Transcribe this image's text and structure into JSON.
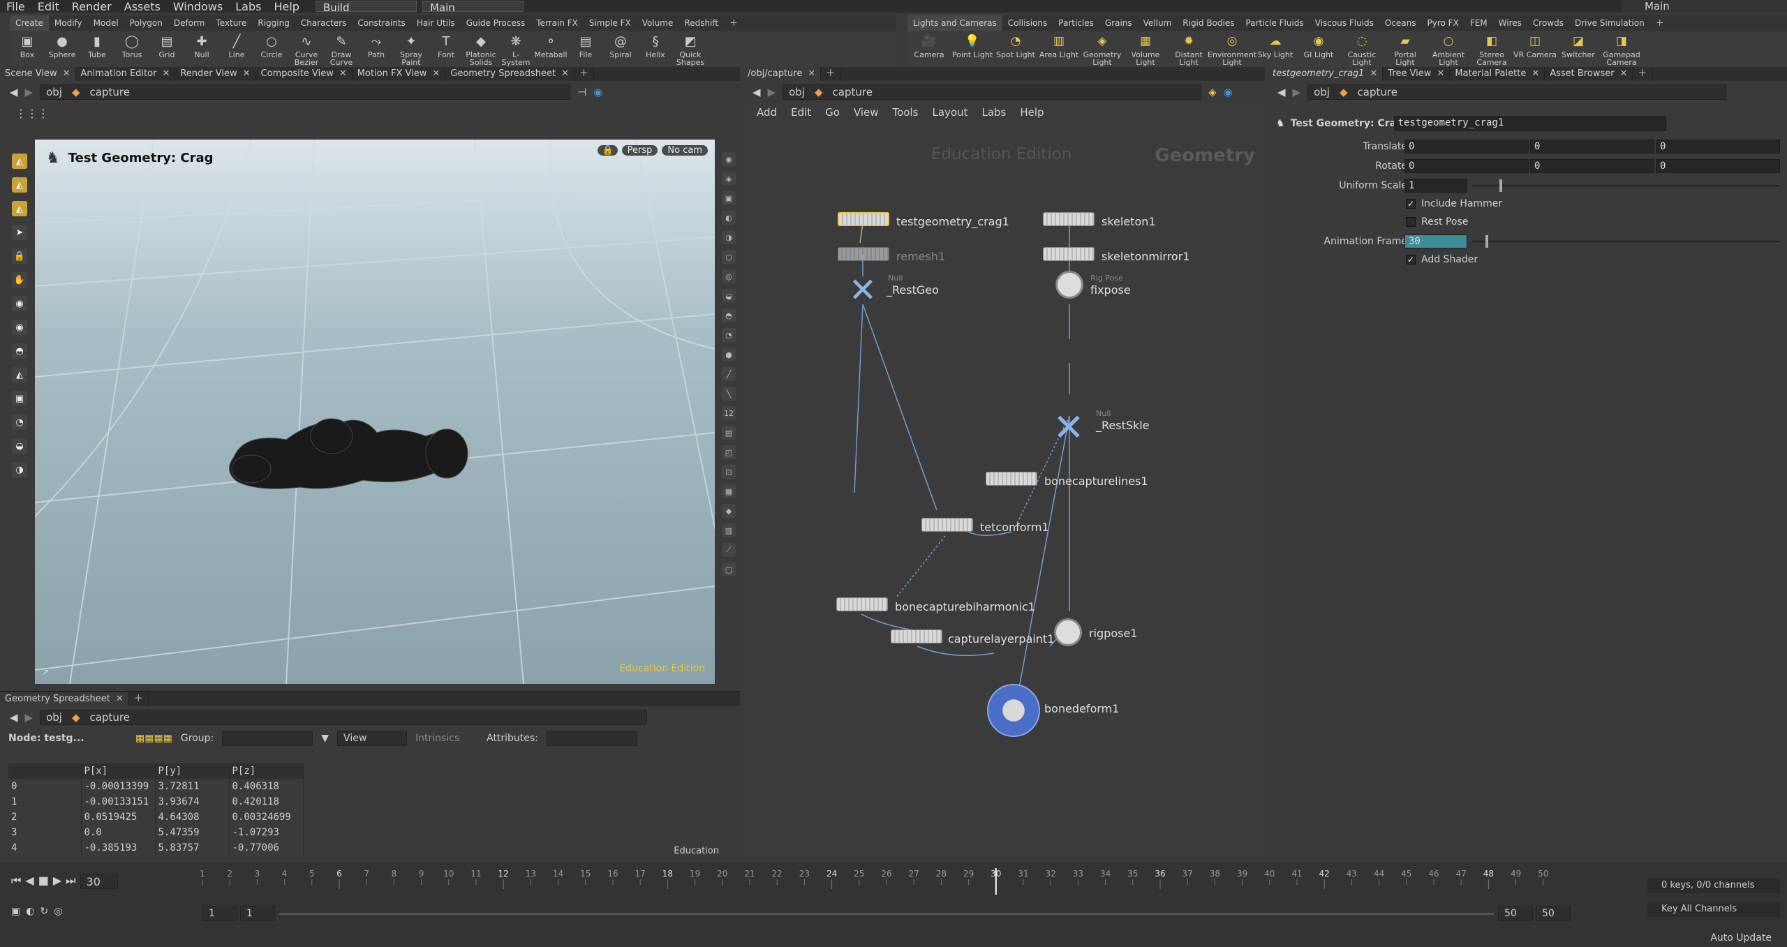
{
  "menu": [
    "File",
    "Edit",
    "Render",
    "Assets",
    "Windows",
    "Labs",
    "Help"
  ],
  "desktop": "Build",
  "workspace": "Main",
  "main_right": "Main",
  "shelf_tabs_left": [
    "Create",
    "Modify",
    "Model",
    "Polygon",
    "Deform",
    "Texture",
    "Rigging",
    "Characters",
    "Constraints",
    "Hair Utils",
    "Guide Process",
    "Terrain FX",
    "Simple FX",
    "Volume",
    "Redshift"
  ],
  "shelf_tabs_right": [
    "Lights and Cameras",
    "Collisions",
    "Particles",
    "Grains",
    "Vellum",
    "Rigid Bodies",
    "Particle Fluids",
    "Viscous Fluids",
    "Oceans",
    "Pyro FX",
    "FEM",
    "Wires",
    "Crowds",
    "Drive Simulation"
  ],
  "tools_left": [
    {
      "label": "Box",
      "icon": "box-icon"
    },
    {
      "label": "Sphere",
      "icon": "sphere-icon"
    },
    {
      "label": "Tube",
      "icon": "tube-icon"
    },
    {
      "label": "Torus",
      "icon": "torus-icon"
    },
    {
      "label": "Grid",
      "icon": "grid-icon"
    },
    {
      "label": "Null",
      "icon": "null-icon"
    },
    {
      "label": "Line",
      "icon": "line-icon"
    },
    {
      "label": "Circle",
      "icon": "circle-icon"
    },
    {
      "label": "Curve Bezier",
      "icon": "curve-bezier-icon"
    },
    {
      "label": "Draw Curve",
      "icon": "draw-curve-icon"
    },
    {
      "label": "Path",
      "icon": "path-icon"
    },
    {
      "label": "Spray Paint",
      "icon": "spray-paint-icon"
    },
    {
      "label": "Font",
      "icon": "font-icon"
    },
    {
      "label": "Platonic Solids",
      "icon": "platonic-icon"
    },
    {
      "label": "L-System",
      "icon": "lsystem-icon"
    },
    {
      "label": "Metaball",
      "icon": "metaball-icon"
    },
    {
      "label": "File",
      "icon": "file-icon"
    },
    {
      "label": "Spiral",
      "icon": "spiral-icon"
    },
    {
      "label": "Helix",
      "icon": "helix-icon"
    },
    {
      "label": "Quick Shapes",
      "icon": "quick-shapes-icon"
    }
  ],
  "tools_right": [
    {
      "label": "Camera"
    },
    {
      "label": "Point Light"
    },
    {
      "label": "Spot Light"
    },
    {
      "label": "Area Light"
    },
    {
      "label": "Geometry Light"
    },
    {
      "label": "Volume Light"
    },
    {
      "label": "Distant Light"
    },
    {
      "label": "Environment Light"
    },
    {
      "label": "Sky Light"
    },
    {
      "label": "GI Light"
    },
    {
      "label": "Caustic Light"
    },
    {
      "label": "Portal Light"
    },
    {
      "label": "Ambient Light"
    },
    {
      "label": "Stereo Camera"
    },
    {
      "label": "VR Camera"
    },
    {
      "label": "Switcher"
    },
    {
      "label": "Gamepad Camera"
    }
  ],
  "left_tabs": [
    "Scene View",
    "Animation Editor",
    "Render View",
    "Composite View",
    "Motion FX View",
    "Geometry Spreadsheet"
  ],
  "mid_tabs": [
    "/obj/capture"
  ],
  "right_tabs": [
    "testgeometry_crag1",
    "Tree View",
    "Material Palette",
    "Asset Browser"
  ],
  "path": {
    "obj": "obj",
    "net": "capture"
  },
  "viewport": {
    "title": "Test Geometry: Crag",
    "persp": "Persp",
    "cam": "No cam",
    "edition": "Education Edition"
  },
  "netmenu": [
    "Add",
    "Edit",
    "Go",
    "View",
    "Tools",
    "Layout",
    "Labs",
    "Help"
  ],
  "net": {
    "watermark": "Education Edition",
    "context": "Geometry",
    "nodes": [
      {
        "id": "n1",
        "label": "testgeometry_crag1"
      },
      {
        "id": "n2",
        "label": "remesh1"
      },
      {
        "id": "n3",
        "label": "_RestGeo",
        "type": "Null"
      },
      {
        "id": "n4",
        "label": "skeleton1"
      },
      {
        "id": "n5",
        "label": "skeletonmirror1"
      },
      {
        "id": "n6",
        "label": "fixpose",
        "type": "Rig Pose"
      },
      {
        "id": "n7",
        "label": "_RestSkle",
        "type": "Null"
      },
      {
        "id": "n8",
        "label": "bonecapturelines1"
      },
      {
        "id": "n9",
        "label": "tetconform1"
      },
      {
        "id": "n10",
        "label": "bonecapturebiharmonic1"
      },
      {
        "id": "n11",
        "label": "capturelayerpaint1"
      },
      {
        "id": "n12",
        "label": "rigpose1"
      },
      {
        "id": "n13",
        "label": "bonedeform1"
      }
    ]
  },
  "params": {
    "header_type": "Test Geometry: Crag",
    "header_name": "testgeometry_crag1",
    "translate_label": "Translate",
    "translate": [
      "0",
      "0",
      "0"
    ],
    "rotate_label": "Rotate",
    "rotate": [
      "0",
      "0",
      "0"
    ],
    "scale_label": "Uniform Scale",
    "scale": "1",
    "hammer_label": "Include Hammer",
    "restpose_label": "Rest Pose",
    "frame_label": "Animation Frame",
    "frame": "30",
    "shader_label": "Add Shader"
  },
  "sheet": {
    "tab": "Geometry Spreadsheet",
    "node": "Node: testg...",
    "group_label": "Group:",
    "view": "View",
    "intrinsics": "Intrinsics",
    "attributes": "Attributes:",
    "columns": [
      "",
      "P[x]",
      "P[y]",
      "P[z]"
    ],
    "rows": [
      [
        "0",
        "-0.00013399",
        "3.72811",
        "0.406318"
      ],
      [
        "1",
        "-0.00133151",
        "3.93674",
        "0.420118"
      ],
      [
        "2",
        "0.0519425",
        "4.64308",
        "0.00324699"
      ],
      [
        "3",
        "0.0",
        "5.47359",
        "-1.07293"
      ],
      [
        "4",
        "-0.385193",
        "5.83757",
        "-0.77006"
      ]
    ],
    "edition": "Education"
  },
  "timeline": {
    "frame": "30",
    "start": "1",
    "start2": "1",
    "end": "50",
    "end2": "50",
    "ticks": [
      "1",
      "2",
      "3",
      "4",
      "5",
      "6",
      "7",
      "8",
      "9",
      "10",
      "11",
      "12",
      "13",
      "14",
      "15",
      "16",
      "17",
      "18",
      "19",
      "20",
      "21",
      "22",
      "23",
      "24",
      "25",
      "26",
      "27",
      "28",
      "29",
      "30",
      "31",
      "32",
      "33",
      "34",
      "35",
      "36",
      "37",
      "38",
      "39",
      "40",
      "41",
      "42",
      "43",
      "44",
      "45",
      "46",
      "47",
      "48",
      "49",
      "50"
    ],
    "keys": "0 keys, 0/0 channels",
    "channels": "Key All Channels",
    "autoupdate": "Auto Update"
  },
  "colors": {
    "accent": "#e8c84a",
    "blue": "#4a90d9",
    "frame": "#3e8d96"
  }
}
